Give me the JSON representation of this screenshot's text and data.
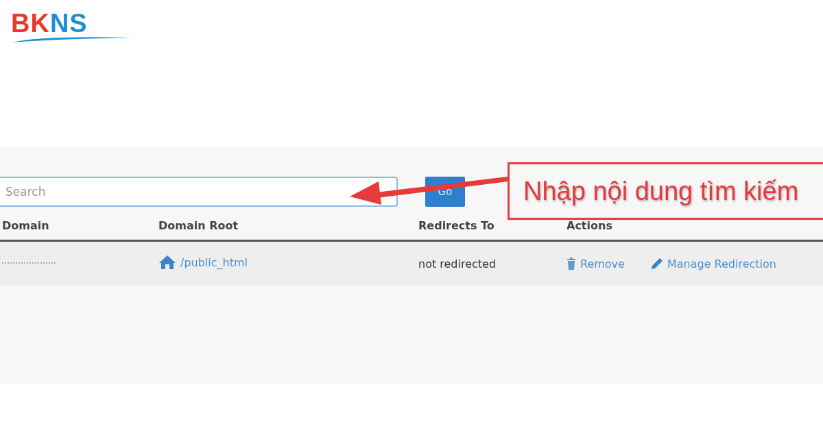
{
  "logo": {
    "parts": [
      {
        "text": "BK",
        "color": "#e8392b"
      },
      {
        "text": "NS",
        "color": "#1d8fd6"
      }
    ]
  },
  "search": {
    "placeholder": "Search",
    "button": "Go"
  },
  "callout": {
    "text": "Nhập nội dung tìm kiếm"
  },
  "table": {
    "columns": [
      "Domain",
      "Domain Root",
      "Redirects To",
      "Actions"
    ],
    "rows": [
      {
        "domain_root": "/public_html",
        "redirects_to": "not redirected",
        "actions": [
          {
            "kind": "remove",
            "label": "Remove"
          },
          {
            "kind": "manage",
            "label": "Manage Redirection"
          }
        ]
      }
    ]
  }
}
